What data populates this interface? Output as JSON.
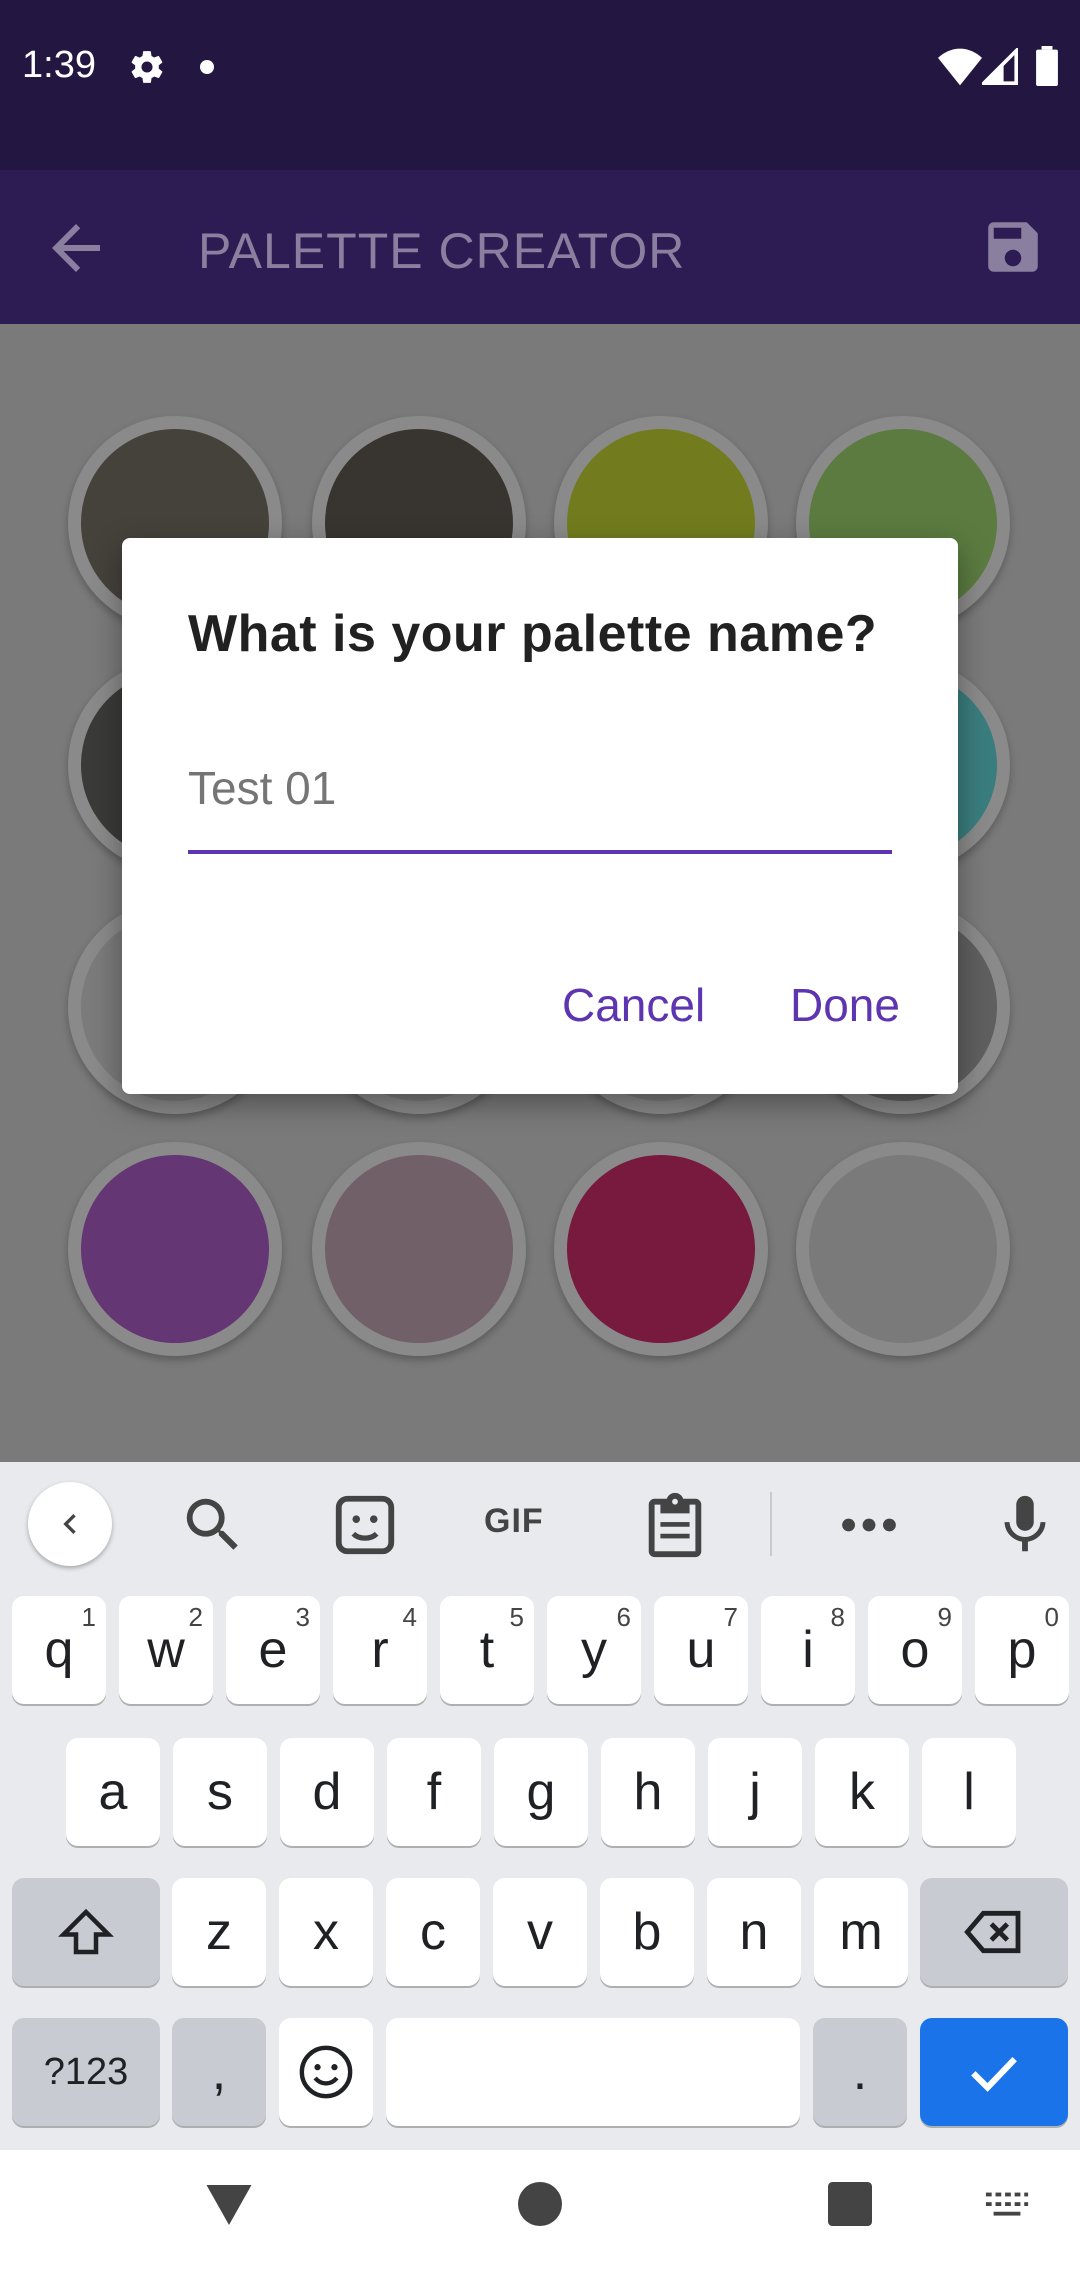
{
  "status_bar": {
    "time": "1:39",
    "icons": [
      "gear-icon",
      "notification-dot",
      "wifi-icon",
      "signal-icon",
      "battery-icon"
    ]
  },
  "app_bar": {
    "title": "PALETTE CREATOR",
    "back_icon": "arrow-back-icon",
    "save_icon": "save-icon"
  },
  "palette": {
    "swatches": [
      {
        "color": "#45423c"
      },
      {
        "color": "#383530"
      },
      {
        "color": "#727c1e"
      },
      {
        "color": "#5b7b40"
      },
      {
        "color": "#3a3b38"
      },
      {
        "color": "#4a4a48"
      },
      {
        "color": "#5d5d5d"
      },
      {
        "color": "#3a7d7e"
      },
      {
        "color": "#7b7b7b"
      },
      {
        "color": "#7a7a7a"
      },
      {
        "color": "#7a7a7a"
      },
      {
        "color": "#5f5f5f"
      },
      {
        "color": "#653674"
      },
      {
        "color": "#716068"
      },
      {
        "color": "#771a3e"
      },
      {
        "color": "#7a7a7a"
      }
    ]
  },
  "dialog": {
    "title": "What is your palette name?",
    "input_value": "Test 01",
    "cancel_label": "Cancel",
    "done_label": "Done",
    "accent_color": "#5e35b1"
  },
  "keyboard": {
    "toolbar": [
      "chevron-left-icon",
      "search-icon",
      "sticker-icon",
      "GIF",
      "clipboard-icon",
      "more-icon",
      "mic-icon"
    ],
    "gif_label": "GIF",
    "row1": [
      {
        "k": "q",
        "h": "1"
      },
      {
        "k": "w",
        "h": "2"
      },
      {
        "k": "e",
        "h": "3"
      },
      {
        "k": "r",
        "h": "4"
      },
      {
        "k": "t",
        "h": "5"
      },
      {
        "k": "y",
        "h": "6"
      },
      {
        "k": "u",
        "h": "7"
      },
      {
        "k": "i",
        "h": "8"
      },
      {
        "k": "o",
        "h": "9"
      },
      {
        "k": "p",
        "h": "0"
      }
    ],
    "row2": [
      "a",
      "s",
      "d",
      "f",
      "g",
      "h",
      "j",
      "k",
      "l"
    ],
    "row3": [
      "z",
      "x",
      "c",
      "v",
      "b",
      "n",
      "m"
    ],
    "symbols_label": "?123",
    "comma_label": ",",
    "period_label": ".",
    "enter_color": "#1a73e8"
  },
  "nav_bar": {
    "icons": [
      "back-triangle-icon",
      "home-circle-icon",
      "recents-square-icon",
      "keyboard-icon"
    ]
  }
}
